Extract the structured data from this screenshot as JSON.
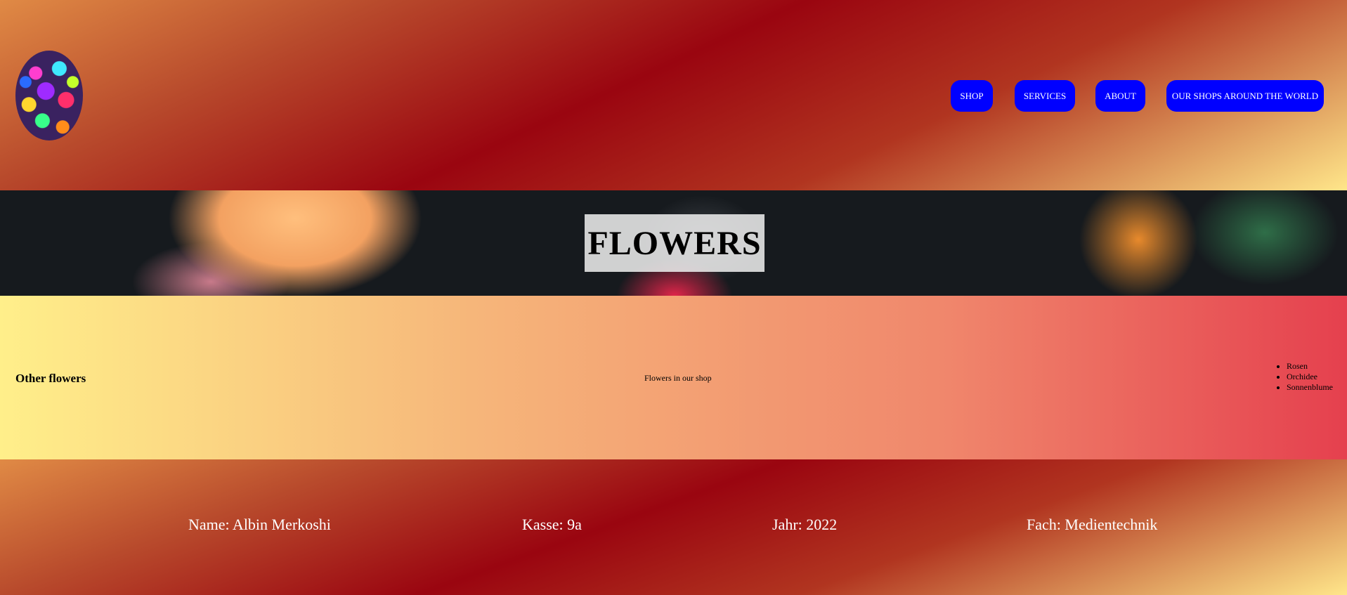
{
  "header": {
    "logo_icon": "rose-bouquet-logo",
    "nav": [
      {
        "label": "SHOP"
      },
      {
        "label": "SERVICES"
      },
      {
        "label": "ABOUT"
      },
      {
        "label": "OUR SHOPS AROUND THE WORLD"
      }
    ],
    "nav_color": "#0000ff"
  },
  "hero": {
    "title": "FLOWERS"
  },
  "content": {
    "heading": "Other flowers",
    "center_text": "Flowers in our shop",
    "flowers": [
      "Rosen",
      "Orchidee",
      "Sonnenblume"
    ]
  },
  "footer": {
    "name": "Name: Albin Merkoshi",
    "class": "Kasse: 9a",
    "year": "Jahr: 2022",
    "subject": "Fach: Medientechnik"
  }
}
